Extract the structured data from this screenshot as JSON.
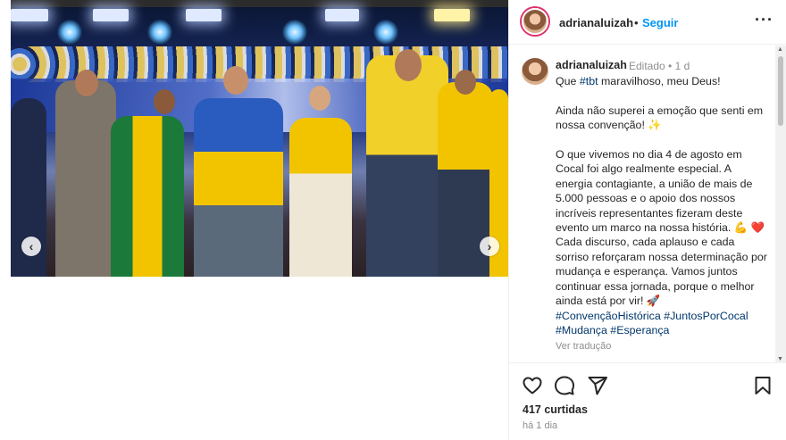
{
  "header": {
    "username": "adrianaluizah",
    "separator": "•",
    "follow_label": "Seguir",
    "more_icon": "ellipsis-icon"
  },
  "caption": {
    "username": "adrianaluizah",
    "edited_label": "Editado",
    "separator": "•",
    "age": "1 d",
    "lines": [
      "Que #tbt maravilhoso, meu Deus!",
      "",
      "Ainda não superei a emoção que senti em nossa convenção! ✨",
      "",
      "O que vivemos no dia 4 de agosto em Cocal foi algo realmente especial. A energia contagiante, a união de mais de 5.000 pessoas e o apoio dos nossos incríveis representantes fizeram deste evento um marco na nossa história. 💪 ❤️ Cada discurso, cada aplauso e cada sorriso reforçaram nossa determinação por mudança e esperança. Vamos juntos continuar essa jornada, porque o melhor ainda está por vir! 🚀"
    ],
    "hashtags_line1": "#ConvençãoHistórica #JuntosPorCocal",
    "hashtags_line2": "#Mudança #Esperança",
    "see_translation": "Ver tradução"
  },
  "actions": {
    "like_icon": "heart-icon",
    "comment_icon": "comment-icon",
    "share_icon": "send-icon",
    "save_icon": "bookmark-icon"
  },
  "stats": {
    "likes": "417 curtidas",
    "time": "há 1 dia"
  },
  "media": {
    "prev_icon": "chevron-left-icon",
    "next_icon": "chevron-right-icon"
  },
  "colors": {
    "follow": "#0095f6",
    "hashtag": "#00376b",
    "muted": "#8e8e8e",
    "story_ring": "#e1306c"
  }
}
